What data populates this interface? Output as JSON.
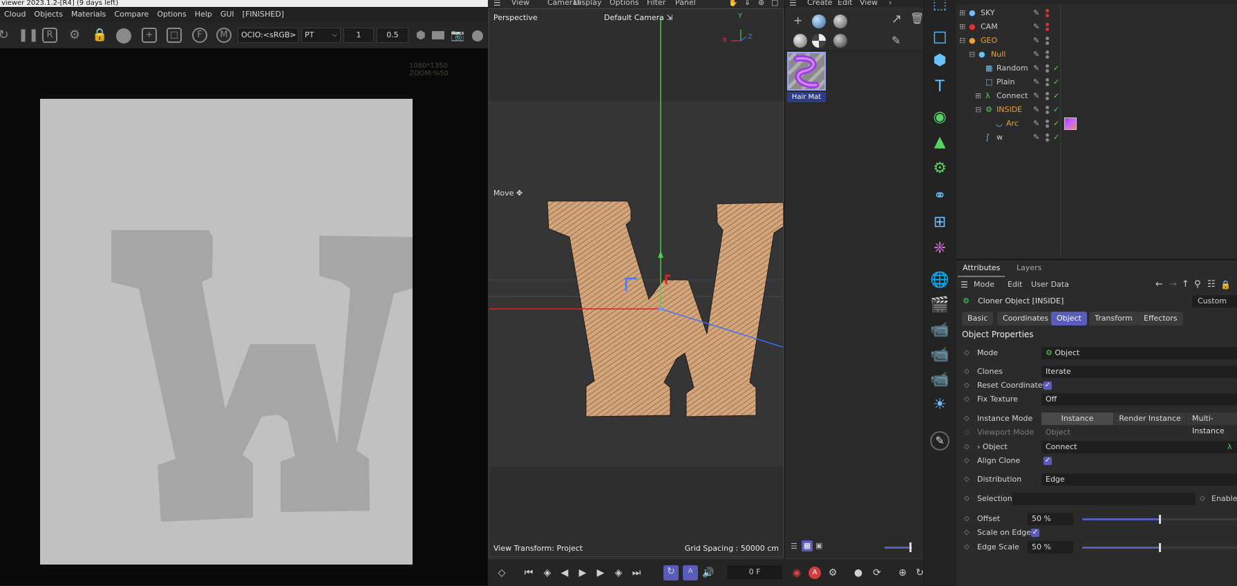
{
  "render_viewer": {
    "title": "viewer 2023.1.2-[R4] (9 days left)",
    "menu": [
      "Cloud",
      "Objects",
      "Materials",
      "Compare",
      "Options",
      "Help",
      "GUI",
      "[FINISHED]"
    ],
    "ocio": "OCIO:<sRGB>",
    "mode": "PT",
    "value1": "1",
    "value2": "0.5",
    "zoom_text": "1080*1350 ZOOM:%50"
  },
  "viewport": {
    "menu": [
      "View",
      "Cameras",
      "Display",
      "Options",
      "Filter",
      "Panel"
    ],
    "label_perspective": "Perspective",
    "label_camera": "Default Camera",
    "label_move": "Move",
    "view_transform": "View Transform: Project",
    "grid_spacing": "Grid Spacing : 50000 cm",
    "axis_y": "Y",
    "axis_x": "X",
    "axis_z": "Z"
  },
  "timeline": {
    "frame": "0 F"
  },
  "material_manager": {
    "menu": [
      "Create",
      "Edit",
      "View"
    ],
    "material_name": "Hair Mat"
  },
  "object_manager": {
    "objects": [
      {
        "name": "SKY",
        "indent": 0,
        "color": "#d6d6d6",
        "icon": "sky-icon"
      },
      {
        "name": "CAM",
        "indent": 0,
        "color": "#d6d6d6",
        "icon": "camera-icon"
      },
      {
        "name": "GEO",
        "indent": 0,
        "color": "#f0a030",
        "icon": "null-icon"
      },
      {
        "name": "Null",
        "indent": 1,
        "color": "#f0a030",
        "icon": "null-icon"
      },
      {
        "name": "Random",
        "indent": 2,
        "color": "#d6d6d6",
        "icon": "random-icon"
      },
      {
        "name": "Plain",
        "indent": 2,
        "color": "#d6d6d6",
        "icon": "plain-icon"
      },
      {
        "name": "Connect",
        "indent": 2,
        "color": "#d6d6d6",
        "icon": "connect-icon"
      },
      {
        "name": "INSIDE",
        "indent": 2,
        "color": "#f0a030",
        "icon": "cloner-icon"
      },
      {
        "name": "Arc",
        "indent": 3,
        "color": "#f0a030",
        "icon": "arc-icon"
      },
      {
        "name": "w",
        "indent": 2,
        "color": "#d6d6d6",
        "icon": "spline-icon"
      }
    ]
  },
  "attributes": {
    "tabs": [
      "Attributes",
      "Layers"
    ],
    "menu": [
      "Mode",
      "Edit",
      "User Data"
    ],
    "object_title": "Cloner Object [INSIDE]",
    "preset": "Custom",
    "sub_tabs": [
      "Basic",
      "Coordinates",
      "Object",
      "Transform",
      "Effectors"
    ],
    "active_sub_tab": "Object",
    "section": "Object Properties",
    "mode_label": "Mode",
    "mode_value": "Object",
    "clones_label": "Clones",
    "clones_value": "Iterate",
    "reset_label": "Reset Coordinates",
    "fix_label": "Fix Texture",
    "fix_value": "Off",
    "instance_label": "Instance Mode",
    "instance_options": [
      "Instance",
      "Render Instance",
      "Multi-Instance"
    ],
    "viewport_label": "Viewport Mode",
    "viewport_value": "Object",
    "object_label": "Object",
    "object_value": "Connect",
    "align_label": "Align Clone",
    "distribution_label": "Distribution",
    "distribution_value": "Edge",
    "selection_label": "Selection",
    "enable_label": "Enable",
    "offset_label": "Offset",
    "offset_value": "50 %",
    "offset_fraction": 0.5,
    "scale_edge_label": "Scale on Edge",
    "edge_scale_label": "Edge Scale",
    "edge_scale_value": "50 %",
    "edge_scale_fraction": 0.5
  }
}
